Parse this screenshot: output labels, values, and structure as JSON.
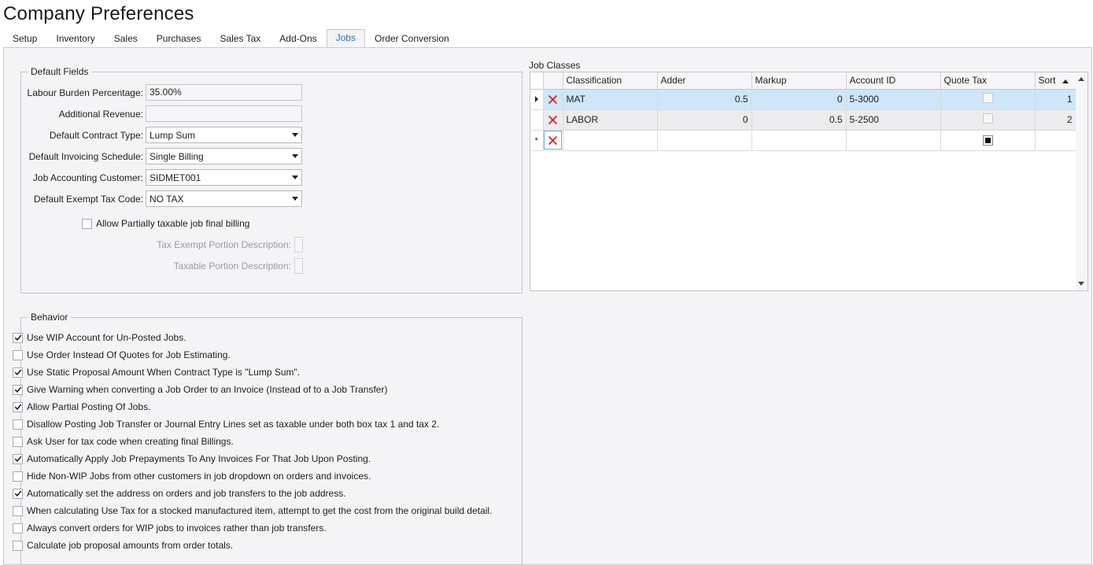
{
  "window": {
    "title": "Company Preferences"
  },
  "tabs": [
    {
      "label": "Setup"
    },
    {
      "label": "Inventory"
    },
    {
      "label": "Sales"
    },
    {
      "label": "Purchases"
    },
    {
      "label": "Sales Tax"
    },
    {
      "label": "Add-Ons"
    },
    {
      "label": "Jobs",
      "active": true
    },
    {
      "label": "Order Conversion"
    }
  ],
  "default_fields": {
    "legend": "Default Fields",
    "labour_burden": {
      "label": "Labour Burden Percentage:",
      "value": "35.00%"
    },
    "additional_revenue": {
      "label": "Additional Revenue:",
      "value": ""
    },
    "contract_type": {
      "label": "Default Contract Type:",
      "value": "Lump Sum"
    },
    "invoicing_schedule": {
      "label": "Default Invoicing Schedule:",
      "value": "Single Billing"
    },
    "accounting_customer": {
      "label": "Job Accounting Customer:",
      "value": "SIDMET001"
    },
    "exempt_tax_code": {
      "label": "Default Exempt Tax Code:",
      "value": "NO TAX"
    },
    "allow_partial_taxable": {
      "label": "Allow Partially taxable job final billing",
      "checked": false
    },
    "tax_exempt_desc": {
      "label": "Tax Exempt Portion Description:"
    },
    "taxable_desc": {
      "label": "Taxable Portion Description:"
    }
  },
  "job_classes": {
    "caption": "Job Classes",
    "columns": {
      "classification": "Classification",
      "adder": "Adder",
      "markup": "Markup",
      "account_id": "Account ID",
      "quote_tax": "Quote Tax",
      "sort": "Sort"
    },
    "rows": [
      {
        "classification": "MAT",
        "adder": "0.5",
        "markup": "0",
        "account_id": "5-3000",
        "quote_tax": false,
        "sort": "1"
      },
      {
        "classification": "LABOR",
        "adder": "0",
        "markup": "0.5",
        "account_id": "5-2500",
        "quote_tax": false,
        "sort": "2"
      }
    ],
    "new_row_marker": "*"
  },
  "behavior": {
    "legend": "Behavior",
    "items": [
      {
        "label": "Use WIP Account for Un-Posted Jobs.",
        "checked": true
      },
      {
        "label": "Use Order Instead Of Quotes for Job Estimating.",
        "checked": false
      },
      {
        "label": "Use Static Proposal Amount When Contract Type is \"Lump Sum\".",
        "checked": true
      },
      {
        "label": "Give Warning when converting a Job Order to an Invoice (Instead of to a Job Transfer)",
        "checked": true
      },
      {
        "label": "Allow Partial Posting Of Jobs.",
        "checked": true
      },
      {
        "label": "Disallow Posting Job Transfer or Journal Entry Lines set as taxable under both box tax 1 and tax 2.",
        "checked": false
      },
      {
        "label": "Ask User for tax code when creating final Billings.",
        "checked": false
      },
      {
        "label": "Automatically Apply Job Prepayments To Any Invoices For That Job Upon Posting.",
        "checked": true
      },
      {
        "label": "Hide Non-WIP Jobs from other customers in job dropdown on orders and invoices.",
        "checked": false
      },
      {
        "label": "Automatically set the address on orders and job transfers to the job address.",
        "checked": true
      },
      {
        "label": "When calculating Use Tax for a stocked manufactured item, attempt to get the cost from the original build detail.",
        "checked": false
      },
      {
        "label": "Always convert orders for WIP jobs to invoices rather than job transfers.",
        "checked": false
      },
      {
        "label": "Calculate job proposal amounts from order totals.",
        "checked": false
      }
    ]
  }
}
